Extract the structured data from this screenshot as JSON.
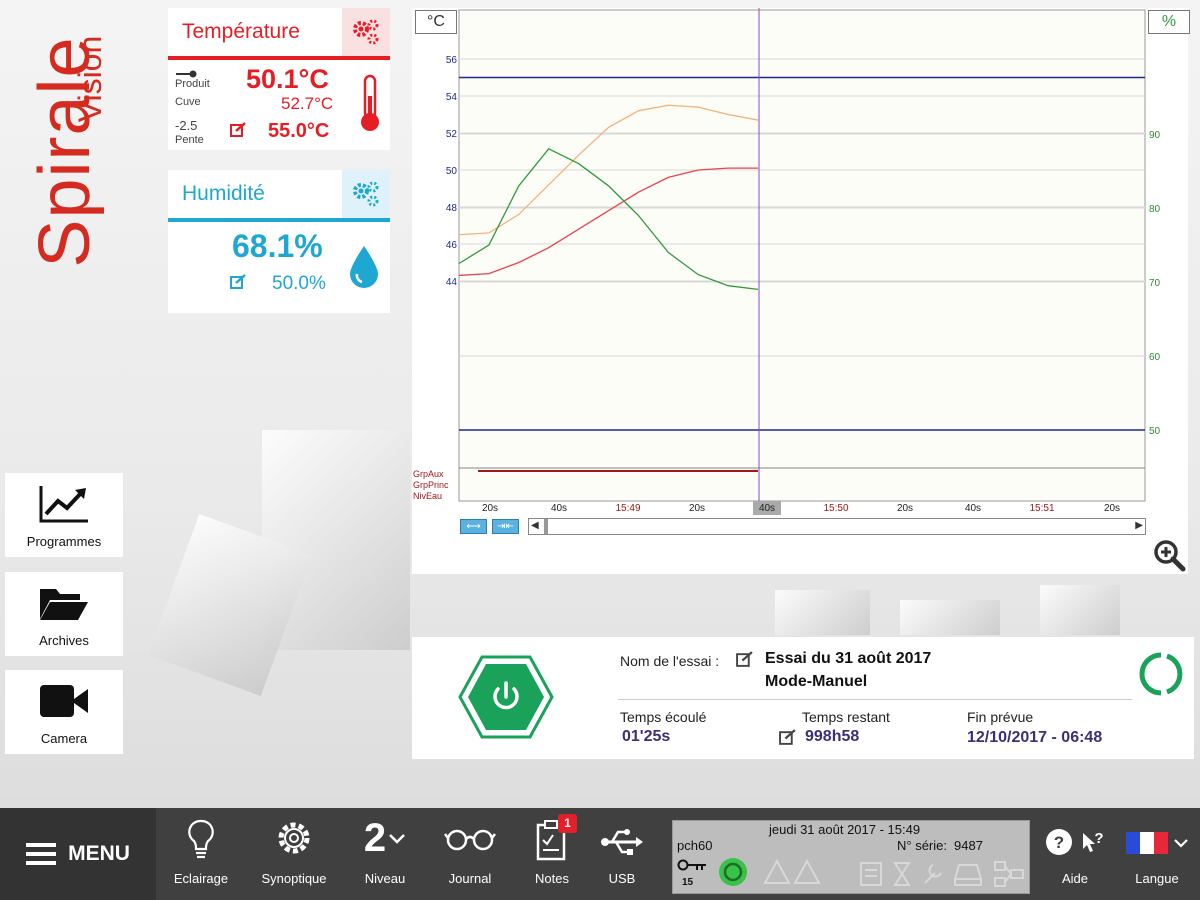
{
  "logo": {
    "main": "Spirale",
    "sub": "Vision"
  },
  "side_buttons": [
    {
      "label": "Programmes",
      "icon": "chart-line-icon"
    },
    {
      "label": "Archives",
      "icon": "folder-open-icon"
    },
    {
      "label": "Camera",
      "icon": "video-camera-icon"
    }
  ],
  "temperature": {
    "title": "Température",
    "produit_label": "Produit",
    "value": "50.1°C",
    "cuve_label": "Cuve",
    "cuve_value": "52.7°C",
    "slope_value": "-2.5",
    "slope_label": "Pente",
    "setpoint": "55.0°C",
    "accent": "#e51e25"
  },
  "humidity": {
    "title": "Humidité",
    "value": "68.1%",
    "setpoint": "50.0%",
    "accent": "#1fa7d3"
  },
  "chart": {
    "left_unit": "°C",
    "right_unit": "%",
    "aux_labels": [
      "GrpAux",
      "GrpPrinc",
      "NivEau"
    ],
    "x_ticks": [
      "20s",
      "40s",
      "15:49",
      "20s",
      "40s",
      "15:50",
      "20s",
      "40s",
      "15:51",
      "20s"
    ]
  },
  "chart_data": {
    "type": "line",
    "left_axis": {
      "unit": "°C",
      "ticks": [
        44,
        46,
        48,
        50,
        52,
        54,
        56
      ]
    },
    "right_axis": {
      "unit": "%",
      "ticks": [
        50,
        60,
        70,
        80,
        90
      ]
    },
    "x_ticks": [
      "20s",
      "40s",
      "15:49",
      "20s",
      "40s",
      "15:50",
      "20s",
      "40s",
      "15:51",
      "20s"
    ],
    "series": [
      {
        "color": "#f5b07a",
        "axis": "left",
        "points": [
          [
            0,
            46.5
          ],
          [
            1,
            46.6
          ],
          [
            2,
            47.6
          ],
          [
            3,
            49.2
          ],
          [
            4,
            50.8
          ],
          [
            5,
            52.3
          ],
          [
            6,
            53.2
          ],
          [
            7,
            53.5
          ],
          [
            8,
            53.4
          ],
          [
            9,
            53.0
          ],
          [
            10,
            52.7
          ]
        ]
      },
      {
        "color": "#e8424a",
        "axis": "left",
        "points": [
          [
            0,
            44.3
          ],
          [
            1,
            44.4
          ],
          [
            2,
            45.0
          ],
          [
            3,
            45.8
          ],
          [
            4,
            46.8
          ],
          [
            5,
            47.8
          ],
          [
            6,
            48.8
          ],
          [
            7,
            49.6
          ],
          [
            8,
            50.0
          ],
          [
            9,
            50.1
          ],
          [
            10,
            50.1
          ]
        ]
      },
      {
        "color": "#2e9a3c",
        "axis": "right",
        "points": [
          [
            0,
            72.5
          ],
          [
            1,
            75
          ],
          [
            2,
            83
          ],
          [
            3,
            88
          ],
          [
            4,
            86
          ],
          [
            5,
            83
          ],
          [
            6,
            79
          ],
          [
            7,
            74
          ],
          [
            8,
            71
          ],
          [
            9,
            69.5
          ],
          [
            10,
            69
          ]
        ]
      },
      {
        "color": "#1f2a8a",
        "axis": "left",
        "points": [
          [
            0,
            55.0
          ],
          [
            10,
            55.0
          ]
        ]
      },
      {
        "color": "#1f2a8a",
        "axis": "right",
        "points": [
          [
            0,
            50.0
          ],
          [
            10,
            50.0
          ]
        ]
      }
    ]
  },
  "trial": {
    "name_label": "Nom de l'essai :",
    "name_value": "Essai du 31 août 2017",
    "mode": "Mode-Manuel",
    "elapsed_label": "Temps écoulé",
    "elapsed_value": "01'25s",
    "remaining_label": "Temps restant",
    "remaining_value": "998h58",
    "end_label": "Fin prévue",
    "end_value": "12/10/2017 - 06:48"
  },
  "taskbar": {
    "menu_label": "MENU",
    "items": [
      {
        "label": "Eclairage",
        "icon": "lightbulb-icon"
      },
      {
        "label": "Synoptique",
        "icon": "gear-icon"
      },
      {
        "label": "Niveau",
        "icon": "level-icon",
        "value": "2"
      },
      {
        "label": "Journal",
        "icon": "glasses-icon"
      },
      {
        "label": "Notes",
        "icon": "clipboard-icon",
        "badge": "1"
      },
      {
        "label": "USB",
        "icon": "usb-icon"
      }
    ],
    "status": {
      "datetime": "jeudi 31 août 2017 - 15:49",
      "device": "pch60",
      "serial_label": "N° série:",
      "serial": "9487",
      "key_count": "15"
    },
    "help_label": "Aide",
    "language_label": "Langue"
  }
}
